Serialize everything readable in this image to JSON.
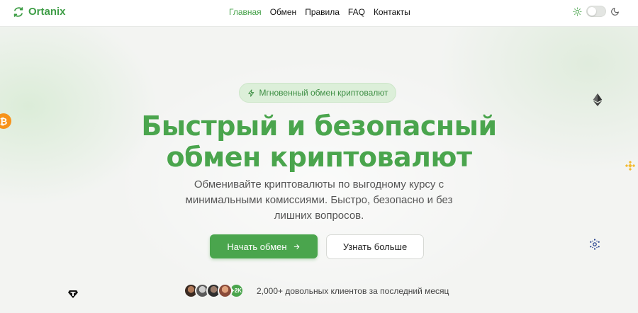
{
  "header": {
    "brand": "Ortanix",
    "nav": [
      {
        "label": "Главная",
        "active": true
      },
      {
        "label": "Обмен",
        "active": false
      },
      {
        "label": "Правила",
        "active": false
      },
      {
        "label": "FAQ",
        "active": false
      },
      {
        "label": "Контакты",
        "active": false
      }
    ],
    "theme_toggle": {
      "icons": [
        "sun-icon",
        "moon-icon"
      ],
      "mode": "light"
    }
  },
  "hero": {
    "badge": "Мгновенный обмен криптовалют",
    "headline_line1": "Быстрый и безопасный",
    "headline_line2": "обмен криптовалют",
    "subtitle": "Обменивайте криптовалюты по выгодному курсу с минимальными комиссиями. Быстро, безопасно и без лишних вопросов.",
    "primary_button": "Начать обмен",
    "secondary_button": "Узнать больше",
    "social_proof": {
      "count_badge": "+2K",
      "text": "2,000+ довольных клиентов за последний месяц"
    }
  },
  "floating_icons": [
    "bitcoin-icon",
    "ethereum-icon",
    "binance-icon",
    "cardano-icon",
    "tether-icon"
  ],
  "colors": {
    "accent": "#4aa54d",
    "accent_dark": "#3e9d46",
    "badge_bg": "#dcefd9",
    "background": "#f3f4f2"
  }
}
